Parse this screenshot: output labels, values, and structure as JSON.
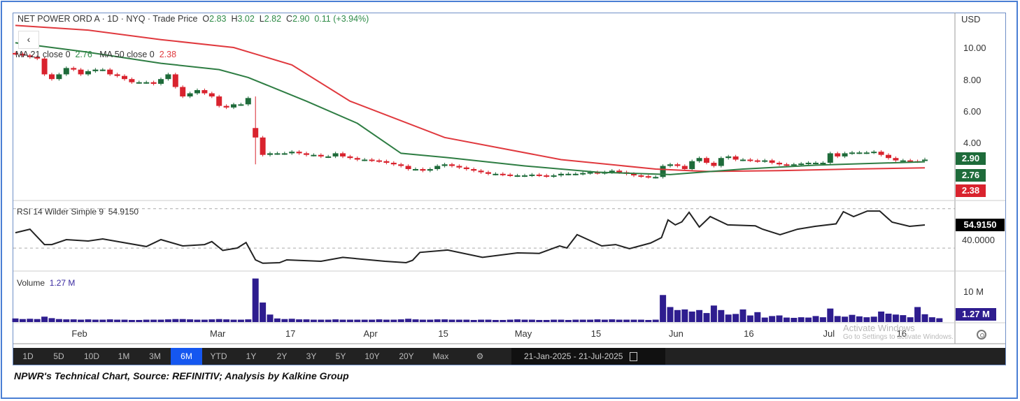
{
  "header": {
    "title": "NET POWER ORD A · 1D · NYQ · Trade Price",
    "o_label": "O",
    "o": "2.83",
    "h_label": "H",
    "h": "3.02",
    "l_label": "L",
    "l": "2.82",
    "c_label": "C",
    "c": "2.90",
    "change": "0.11 (+3.94%)"
  },
  "ma_legend": {
    "ma21_label": "MA 21 close 0",
    "ma21_value": "2.76",
    "ma50_label": "MA 50 close 0",
    "ma50_value": "2.38"
  },
  "back_label": "‹",
  "currency": "USD",
  "price_ticks": [
    "10.00",
    "8.00",
    "6.00",
    "4.00"
  ],
  "price_tags": {
    "last": "2.90",
    "ma21": "2.76",
    "ma50": "2.38"
  },
  "rsi": {
    "label": "RSI 14 Wilder Simple 9",
    "value": "54.9150",
    "tick": "40.0000"
  },
  "volume": {
    "label": "Volume",
    "value": "1.27 M",
    "tick": "10 M",
    "tag": "1.27 M"
  },
  "dates": [
    "Feb",
    "Mar",
    "17",
    "Apr",
    "15",
    "May",
    "15",
    "Jun",
    "16",
    "Jul",
    "16"
  ],
  "toolbar": {
    "buttons": [
      "1D",
      "5D",
      "10D",
      "1M",
      "3M",
      "6M",
      "YTD",
      "1Y",
      "2Y",
      "3Y",
      "5Y",
      "10Y",
      "20Y",
      "Max"
    ],
    "selected": "6M",
    "range_from": "21-Jan-2025",
    "range_sep": "-",
    "range_to": "21-Jul-2025"
  },
  "watermark": {
    "title": "Activate Windows",
    "sub": "Go to Settings to activate Windows."
  },
  "caption": "NPWR's Technical Chart, Source: REFINITIV; Analysis by Kalkine Group",
  "colors": {
    "up": "#1e6b3a",
    "down": "#d9232e",
    "ma21": "#2e7d43",
    "ma50": "#e0393e",
    "volume": "#2e1d8f",
    "rsi": "#222222",
    "selected": "#1557f0"
  },
  "chart_data": {
    "type": "candlestick",
    "date_index_labels": {
      "0": "21-Jan-2025",
      "125": "21-Jul-2025"
    },
    "price_ylim": [
      0.6,
      11.5
    ],
    "closes": [
      9.6,
      9.5,
      9.4,
      9.3,
      8.3,
      8.0,
      8.3,
      8.7,
      8.6,
      8.3,
      8.5,
      8.6,
      8.6,
      8.3,
      8.2,
      8.0,
      7.8,
      7.8,
      7.8,
      7.7,
      8.0,
      8.3,
      7.5,
      6.9,
      7.1,
      7.3,
      7.1,
      6.9,
      6.3,
      6.2,
      6.4,
      6.4,
      6.8,
      4.3,
      3.2,
      3.3,
      3.3,
      3.3,
      3.4,
      3.3,
      3.2,
      3.2,
      3.1,
      3.1,
      3.3,
      3.1,
      3.0,
      2.9,
      2.9,
      2.85,
      2.8,
      2.7,
      2.6,
      2.5,
      2.3,
      2.3,
      2.2,
      2.3,
      2.5,
      2.6,
      2.5,
      2.4,
      2.3,
      2.2,
      2.1,
      2.0,
      2.0,
      1.95,
      1.9,
      1.9,
      1.9,
      1.95,
      1.9,
      1.85,
      1.9,
      2.0,
      2.0,
      2.0,
      2.05,
      2.1,
      2.05,
      2.1,
      2.2,
      2.1,
      2.0,
      1.9,
      1.85,
      1.8,
      1.8,
      2.5,
      2.6,
      2.5,
      2.3,
      2.8,
      3.0,
      2.7,
      2.5,
      3.0,
      3.1,
      2.9,
      2.9,
      2.85,
      2.8,
      2.85,
      2.7,
      2.6,
      2.55,
      2.6,
      2.65,
      2.7,
      2.7,
      2.7,
      3.3,
      3.1,
      3.3,
      3.35,
      3.35,
      3.35,
      3.4,
      3.2,
      3.0,
      2.85,
      2.85,
      2.8,
      2.79,
      2.9
    ],
    "big_drop": {
      "index": 33,
      "open": 4.9,
      "low": 2.6
    },
    "ma21": [
      [
        0,
        10.3
      ],
      [
        10,
        9.7
      ],
      [
        20,
        9.0
      ],
      [
        28,
        8.6
      ],
      [
        32,
        8.1
      ],
      [
        40,
        6.6
      ],
      [
        47,
        5.2
      ],
      [
        53,
        3.3
      ],
      [
        60,
        3.0
      ],
      [
        70,
        2.5
      ],
      [
        80,
        2.1
      ],
      [
        90,
        1.95
      ],
      [
        100,
        2.3
      ],
      [
        110,
        2.55
      ],
      [
        125,
        2.76
      ]
    ],
    "ma50": [
      [
        0,
        11.4
      ],
      [
        10,
        11.1
      ],
      [
        20,
        10.5
      ],
      [
        30,
        10.0
      ],
      [
        38,
        8.9
      ],
      [
        46,
        6.6
      ],
      [
        59,
        4.3
      ],
      [
        75,
        2.9
      ],
      [
        88,
        2.3
      ],
      [
        95,
        2.15
      ],
      [
        105,
        2.2
      ],
      [
        115,
        2.3
      ],
      [
        125,
        2.38
      ]
    ],
    "rsi_ylim": [
      10,
      80
    ],
    "rsi_bands": [
      70,
      30
    ],
    "rsi": [
      [
        0,
        47
      ],
      [
        2,
        50.6
      ],
      [
        4,
        35
      ],
      [
        5,
        35
      ],
      [
        7,
        40
      ],
      [
        10,
        38.6
      ],
      [
        12,
        40.7
      ],
      [
        18,
        33
      ],
      [
        20,
        40
      ],
      [
        23,
        33.6
      ],
      [
        26,
        35
      ],
      [
        27,
        38
      ],
      [
        28.5,
        29
      ],
      [
        30.5,
        31.5
      ],
      [
        31.7,
        37
      ],
      [
        33,
        19.4
      ],
      [
        34,
        16
      ],
      [
        36.3,
        16.6
      ],
      [
        37.3,
        19.4
      ],
      [
        42,
        18
      ],
      [
        45,
        22
      ],
      [
        50.8,
        18
      ],
      [
        53.7,
        16.6
      ],
      [
        54.6,
        19
      ],
      [
        55.6,
        27
      ],
      [
        59.4,
        29.4
      ],
      [
        64.2,
        22
      ],
      [
        69,
        26.5
      ],
      [
        72,
        26
      ],
      [
        74.8,
        33.6
      ],
      [
        75.8,
        31.5
      ],
      [
        77.2,
        45
      ],
      [
        80.6,
        33.6
      ],
      [
        82.5,
        35
      ],
      [
        84.4,
        30.8
      ],
      [
        87.3,
        36.5
      ],
      [
        88.8,
        42
      ],
      [
        89.7,
        60
      ],
      [
        90.7,
        55
      ],
      [
        91.6,
        58
      ],
      [
        92.6,
        67.7
      ],
      [
        94,
        52.8
      ],
      [
        95.5,
        63.4
      ],
      [
        97.9,
        55
      ],
      [
        101.7,
        54
      ],
      [
        102.7,
        50.6
      ],
      [
        105.1,
        45
      ],
      [
        107.5,
        50.6
      ],
      [
        109.9,
        53.5
      ],
      [
        112.8,
        56
      ],
      [
        113.8,
        68.4
      ],
      [
        115.2,
        63.4
      ],
      [
        117.1,
        69
      ],
      [
        118.8,
        69
      ],
      [
        120.5,
        57.7
      ],
      [
        122.9,
        53.5
      ],
      [
        125,
        54.915
      ]
    ],
    "volume_ylim_millions": [
      0,
      15
    ],
    "volume_millions": [
      1.2,
      1.0,
      1.1,
      1.0,
      1.8,
      1.3,
      1.0,
      0.9,
      0.9,
      0.8,
      0.9,
      0.8,
      0.8,
      0.9,
      0.8,
      0.8,
      0.7,
      0.7,
      0.8,
      0.8,
      0.8,
      0.9,
      1.0,
      1.0,
      0.9,
      0.8,
      0.8,
      0.9,
      1.0,
      0.9,
      0.8,
      0.8,
      0.9,
      14.5,
      6.5,
      2.5,
      1.2,
      1.0,
      1.1,
      0.9,
      0.9,
      0.8,
      0.8,
      0.8,
      0.9,
      0.8,
      0.8,
      0.8,
      0.8,
      0.8,
      0.9,
      0.8,
      0.8,
      0.9,
      1.1,
      0.9,
      0.8,
      0.8,
      0.9,
      0.9,
      0.8,
      0.8,
      0.8,
      0.7,
      0.8,
      0.8,
      0.7,
      0.7,
      0.8,
      0.9,
      0.8,
      0.8,
      0.7,
      0.7,
      0.8,
      0.8,
      0.7,
      0.8,
      0.8,
      0.8,
      0.9,
      0.8,
      0.9,
      0.8,
      0.8,
      0.8,
      0.8,
      0.7,
      0.8,
      9.0,
      5.0,
      4.0,
      4.2,
      3.5,
      4.0,
      3.0,
      5.5,
      4.0,
      2.5,
      2.7,
      4.2,
      2.2,
      3.3,
      1.5,
      2.0,
      2.2,
      1.5,
      1.4,
      1.6,
      1.5,
      2.0,
      1.6,
      4.5,
      2.0,
      1.8,
      2.4,
      1.9,
      1.6,
      1.8,
      3.5,
      2.8,
      2.5,
      2.3,
      1.6,
      5.0,
      2.6,
      1.6,
      1.27
    ],
    "xlabels_index": {
      "Feb": 9,
      "Mar": 28,
      "17": 38,
      "Apr": 49,
      "15a": 59,
      "May": 70,
      "15b": 80,
      "Jun": 91,
      "16a": 101,
      "Jul": 112,
      "16b": 122
    }
  }
}
